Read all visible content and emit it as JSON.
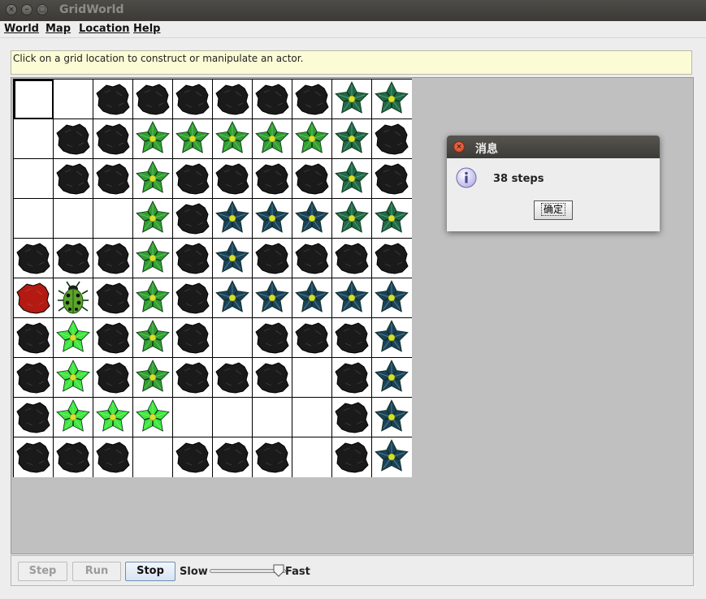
{
  "window": {
    "title": "GridWorld",
    "buttons": [
      "close",
      "minimize",
      "maximize"
    ]
  },
  "menu": {
    "items": [
      "World",
      "Map",
      "Location",
      "Help"
    ]
  },
  "message": "Click on a grid location to construct or manipulate an actor.",
  "grid": {
    "rows": 10,
    "cols": 10,
    "selected": [
      0,
      0
    ],
    "cells": [
      [
        "empty",
        "empty",
        "rock",
        "rock",
        "rock",
        "rock",
        "rock",
        "rock",
        "flower-dark",
        "flower-dark"
      ],
      [
        "empty",
        "rock",
        "rock",
        "flower-green",
        "flower-green",
        "flower-green",
        "flower-green",
        "flower-green",
        "flower-dark",
        "rock"
      ],
      [
        "empty",
        "rock",
        "rock",
        "flower-green",
        "rock",
        "rock",
        "rock",
        "rock",
        "flower-dark",
        "rock"
      ],
      [
        "empty",
        "empty",
        "empty",
        "flower-green",
        "rock",
        "flower-darker",
        "flower-darker",
        "flower-darker",
        "flower-dark",
        "flower-dark"
      ],
      [
        "rock",
        "rock",
        "rock",
        "flower-green",
        "rock",
        "flower-darker",
        "rock",
        "rock",
        "rock",
        "rock"
      ],
      [
        "rock-red",
        "bug",
        "rock",
        "flower-green",
        "rock",
        "flower-darker",
        "flower-darker",
        "flower-darker",
        "flower-darker",
        "flower-darker"
      ],
      [
        "rock",
        "flower-bright",
        "rock",
        "flower-green",
        "rock",
        "empty",
        "rock",
        "rock",
        "rock",
        "flower-darker"
      ],
      [
        "rock",
        "flower-bright",
        "rock",
        "flower-green",
        "rock",
        "rock",
        "rock",
        "empty",
        "rock",
        "flower-darker"
      ],
      [
        "rock",
        "flower-bright",
        "flower-bright",
        "flower-bright",
        "empty",
        "empty",
        "empty",
        "empty",
        "rock",
        "flower-darker"
      ],
      [
        "rock",
        "rock",
        "rock",
        "empty",
        "rock",
        "rock",
        "rock",
        "empty",
        "rock",
        "flower-darker"
      ]
    ]
  },
  "controls": {
    "step_label": "Step",
    "run_label": "Run",
    "stop_label": "Stop",
    "slow_label": "Slow",
    "fast_label": "Fast",
    "speed_fraction": 0.9
  },
  "dialog": {
    "title": "消息",
    "message": "38 steps",
    "ok_label": "确定",
    "icon": "info-icon"
  },
  "colors": {
    "rock": "#1a1a1a",
    "rock_red": "#b31a12",
    "flower_green": "#2fa02f",
    "flower_bright": "#3ee83e",
    "flower_dark": "#1d6b45",
    "flower_darker": "#18425a",
    "bug": "#5aa62a",
    "message_bg": "#fbfbd6",
    "grid_bg": "#c0c0c0"
  }
}
